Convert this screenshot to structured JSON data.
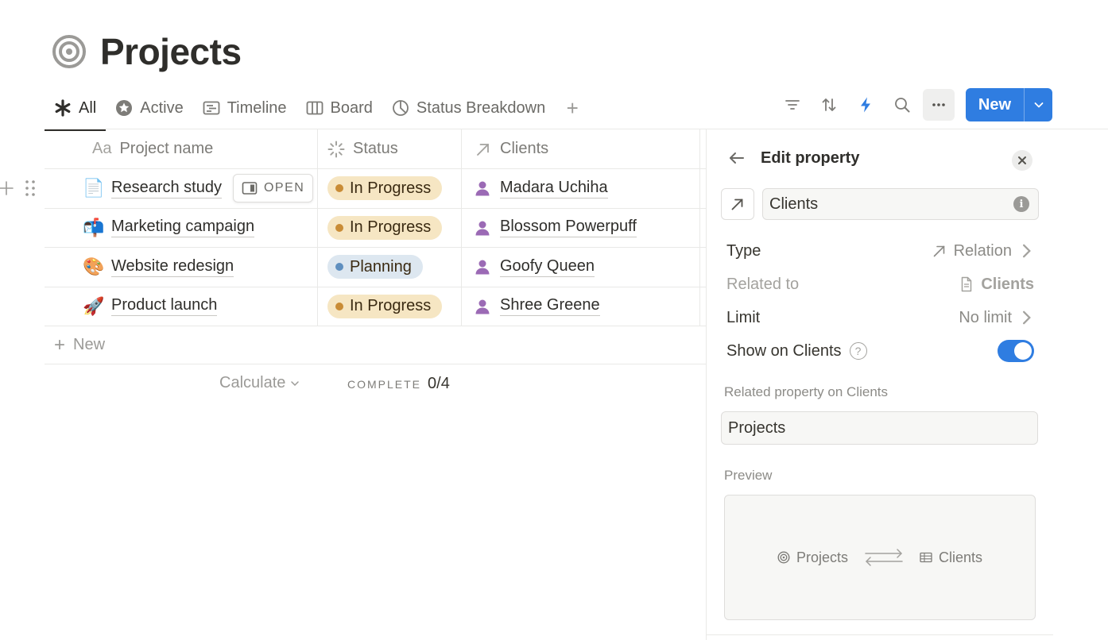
{
  "page": {
    "title": "Projects"
  },
  "tabs": [
    {
      "label": "All",
      "icon": "asterisk-icon",
      "active": true
    },
    {
      "label": "Active",
      "icon": "star-circle-icon"
    },
    {
      "label": "Timeline",
      "icon": "timeline-icon"
    },
    {
      "label": "Board",
      "icon": "board-icon"
    },
    {
      "label": "Status Breakdown",
      "icon": "pie-chart-icon"
    }
  ],
  "toolbar": {
    "new_label": "New"
  },
  "table": {
    "columns": [
      {
        "label": "Project name",
        "prefix": "Aa"
      },
      {
        "label": "Status"
      },
      {
        "label": "Clients"
      }
    ],
    "open_label": "OPEN",
    "rows": [
      {
        "emoji": "📄",
        "name": "Research study",
        "status": "In Progress",
        "client": "Madara Uchiha"
      },
      {
        "emoji": "📬",
        "name": "Marketing campaign",
        "status": "In Progress",
        "client": "Blossom Powerpuff"
      },
      {
        "emoji": "🎨",
        "name": "Website redesign",
        "status": "Planning",
        "client": "Goofy Queen"
      },
      {
        "emoji": "🚀",
        "name": "Product launch",
        "status": "In Progress",
        "client": "Shree Greene"
      }
    ],
    "new_label": "New",
    "calculate_label": "Calculate",
    "complete_label": "COMPLETE",
    "complete_value": "0/4"
  },
  "status_colors": {
    "In Progress": {
      "bg": "#f6e6c3",
      "dot": "#c98c36"
    },
    "Planning": {
      "bg": "#dde7f0",
      "dot": "#5f8fbf"
    }
  },
  "panel": {
    "title": "Edit property",
    "property_name": "Clients",
    "type_label": "Type",
    "type_value": "Relation",
    "related_to_label": "Related to",
    "related_to_value": "Clients",
    "limit_label": "Limit",
    "limit_value": "No limit",
    "show_on_label": "Show on Clients",
    "show_on_enabled": true,
    "related_property_label": "Related property on Clients",
    "related_property_value": "Projects",
    "preview_label": "Preview",
    "preview_from": "Projects",
    "preview_to": "Clients"
  },
  "colors": {
    "accent": "#2f7de1",
    "person": "#9b6ab5"
  }
}
